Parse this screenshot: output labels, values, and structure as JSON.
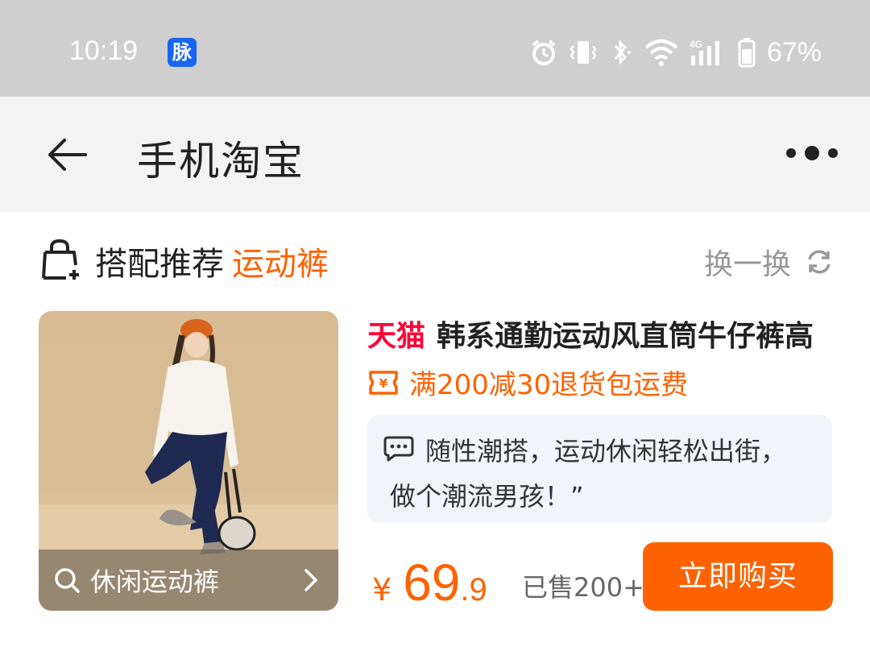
{
  "status_bar": {
    "time": "10:19",
    "app_badge": "脉",
    "battery": "67%",
    "icons": [
      "alarm-icon",
      "vibrate-icon",
      "bluetooth-icon",
      "wifi-icon",
      "4g-signal-icon",
      "battery-icon"
    ]
  },
  "nav": {
    "title": "手机淘宝",
    "back_icon": "arrow-left-icon",
    "more_icon": "more-dots-icon"
  },
  "section": {
    "title": "搭配推荐",
    "keyword": "运动裤",
    "refresh_label": "换一换"
  },
  "product": {
    "image_search_text": "休闲运动裤",
    "brand": "天猫",
    "title": "韩系通勤运动风直筒牛仔裤高",
    "promo": "满200减30退货包运费",
    "quote_line1": "随性潮搭，运动休闲轻松出街，",
    "quote_line2": "做个潮流男孩！”",
    "price_symbol": "¥",
    "price_int": "69",
    "price_dec": ".9",
    "sold": "已售200+",
    "buy_label": "立即购买"
  },
  "colors": {
    "accent": "#ff6200",
    "tmall": "#ff0036",
    "status_bar_bg": "#cfcfcf",
    "nav_bg": "#f3f3f3"
  }
}
